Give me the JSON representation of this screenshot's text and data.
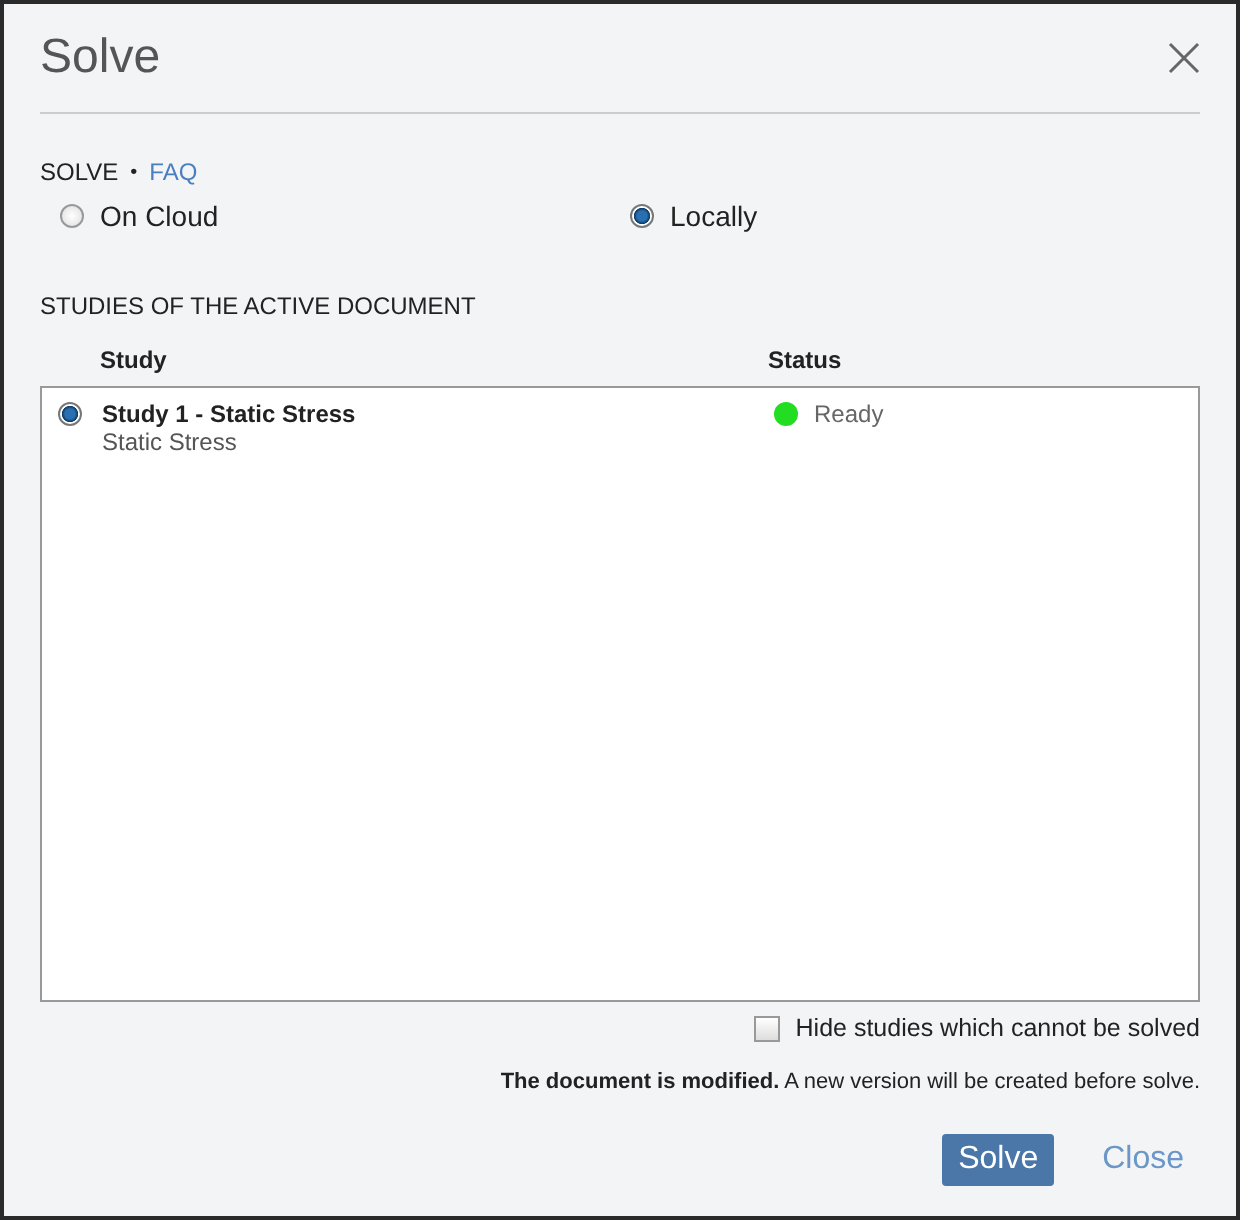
{
  "window": {
    "title": "Solve"
  },
  "solve_section": {
    "label": "SOLVE",
    "separator": "•",
    "link": "FAQ"
  },
  "solve_options": [
    {
      "label": "On Cloud",
      "selected": false
    },
    {
      "label": "Locally",
      "selected": true
    }
  ],
  "studies_section": {
    "label": "STUDIES OF THE ACTIVE DOCUMENT"
  },
  "table": {
    "columns": [
      "Study",
      "Status"
    ],
    "rows": [
      {
        "name": "Study 1 - Static Stress",
        "type": "Static Stress",
        "status": "Ready",
        "color": "#22dd22",
        "selected": true
      }
    ]
  },
  "hide_option": {
    "label": "Hide studies which cannot be solved",
    "checked": false
  },
  "notice": "**The document is modified.** A new version will be created before solve.",
  "buttons": [
    {
      "label": "Solve",
      "kind": "primary"
    },
    {
      "label": "Close",
      "kind": "link"
    }
  ]
}
